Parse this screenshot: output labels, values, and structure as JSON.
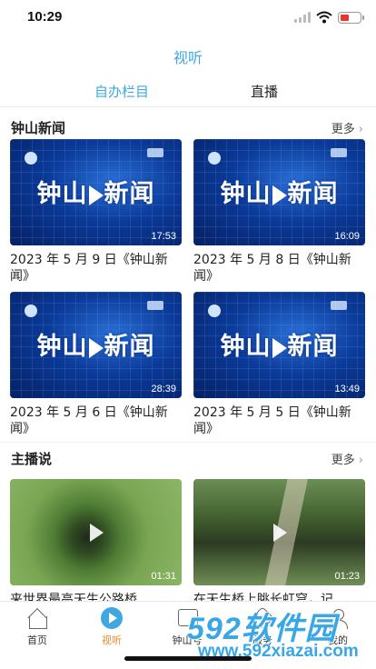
{
  "status_bar": {
    "time": "10:29"
  },
  "nav": {
    "title": "视听"
  },
  "tabs": [
    {
      "label": "自办栏目",
      "active": true
    },
    {
      "label": "直播",
      "active": false
    }
  ],
  "sections": [
    {
      "title": "钟山新闻",
      "more": "更多",
      "items": [
        {
          "thumb_text": "钟山新闻",
          "duration": "17:53",
          "caption": "2023 年 5 月 9 日《钟山新闻》"
        },
        {
          "thumb_text": "钟山新闻",
          "duration": "16:09",
          "caption": "2023 年 5 月 8 日《钟山新闻》"
        },
        {
          "thumb_text": "钟山新闻",
          "duration": "28:39",
          "caption": "2023 年 5 月 6 日《钟山新闻》"
        },
        {
          "thumb_text": "钟山新闻",
          "duration": "13:49",
          "caption": "2023 年 5 月 5 日《钟山新闻》"
        }
      ]
    },
    {
      "title": "主播说",
      "more": "更多",
      "items": [
        {
          "duration": "01:31",
          "caption": "来世界最高天生公路桥"
        },
        {
          "duration": "01:23",
          "caption": "在天生桥上眺长虹穹，记"
        }
      ]
    }
  ],
  "tabbar": [
    {
      "label": "首页",
      "icon": "home-icon",
      "active": false
    },
    {
      "label": "视听",
      "icon": "video-icon",
      "active": true
    },
    {
      "label": "钟山号",
      "icon": "tv-icon",
      "active": false
    },
    {
      "label": "服务",
      "icon": "service-icon",
      "active": false
    },
    {
      "label": "我的",
      "icon": "me-icon",
      "active": false
    }
  ],
  "watermark": {
    "brand": "592软件园",
    "url": "www.592xiazai.com"
  },
  "colors": {
    "accent": "#3fa8e0",
    "active_tab_label": "#f08a2b",
    "watermark": "#39a7e6"
  }
}
